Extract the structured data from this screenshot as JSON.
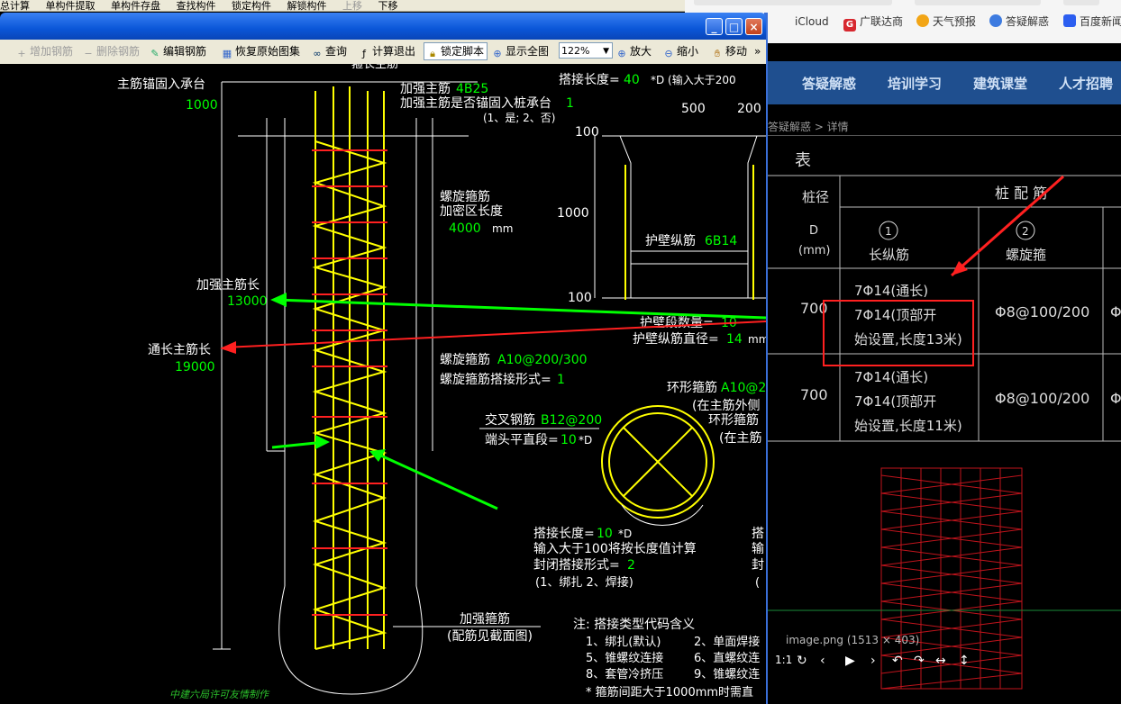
{
  "top_menu": [
    "总计算",
    "单构件提取",
    "单构件存盘",
    "查找构件",
    "锁定构件",
    "解锁构件",
    "上移",
    "下移"
  ],
  "browser": {
    "favorites": [
      {
        "label": "iCloud",
        "icon": "apple-icon"
      },
      {
        "label": "广联达商",
        "icon": "glodon-g-icon",
        "color": "#d7282f"
      },
      {
        "label": "天气预报",
        "icon": "weather-sun-icon",
        "color": "#f2a516"
      },
      {
        "label": "答疑解惑",
        "icon": "bulb-icon",
        "color": "#3d7be0"
      },
      {
        "label": "百度新闻",
        "icon": "baidu-paw-icon",
        "color": "#2c5ef0"
      }
    ],
    "nav": [
      "答疑解惑",
      "培训学习",
      "建筑课堂",
      "人才招聘"
    ],
    "breadcrumb": "答疑解惑 > 详情",
    "table": {
      "title_fragment": "表",
      "col_header_pile": "桩径",
      "col_header_d": "D",
      "col_header_unit": "(mm)",
      "col_header_config": "桩 配 筋",
      "col1_num": "1",
      "col1_label": "长纵筋",
      "col2_num": "2",
      "col2_label": "螺旋箍",
      "rows": [
        {
          "d": "700",
          "long_1": "7Φ14(通长)",
          "long_2": "7Φ14(顶部开",
          "long_3": "始设置,长度13米)",
          "spiral": "Φ8@100/200",
          "extra": "Φ"
        },
        {
          "d": "700",
          "long_1": "7Φ14(通长)",
          "long_2": "7Φ14(顶部开",
          "long_3": "始设置,长度11米)",
          "spiral": "Φ8@100/200",
          "extra": "Φ"
        }
      ]
    },
    "viewer": {
      "caption": "image.png (1513 × 403)",
      "controls": [
        "1:1",
        "↻",
        "‹",
        "▶",
        "›",
        "↶",
        "↷",
        "↔",
        "↕"
      ]
    }
  },
  "window": {
    "toolbar": [
      {
        "label": "增加钢筋",
        "disabled": true,
        "icon": "add-rebar-icon"
      },
      {
        "label": "删除钢筋",
        "disabled": true,
        "icon": "delete-rebar-icon"
      },
      {
        "label": "编辑钢筋",
        "disabled": false,
        "icon": "edit-rebar-icon"
      },
      {
        "label": "恢复原始图集",
        "disabled": false,
        "icon": "restore-icon"
      },
      {
        "label": "查询",
        "disabled": false,
        "icon": "binoculars-icon"
      },
      {
        "label": "计算退出",
        "disabled": false,
        "icon": "calc-exit-icon"
      },
      {
        "label": "锁定脚本",
        "disabled": false,
        "icon": "lock-icon",
        "pressed": true
      },
      {
        "label": "显示全图",
        "disabled": false,
        "icon": "fit-view-icon"
      },
      {
        "label": "放大",
        "disabled": false,
        "icon": "zoom-in-icon"
      },
      {
        "label": "缩小",
        "disabled": false,
        "icon": "zoom-out-icon"
      },
      {
        "label": "移动",
        "disabled": false,
        "icon": "hand-move-icon"
      }
    ],
    "zoom_value": "122%",
    "more": "»"
  },
  "cad": {
    "texts": {
      "top_cut": "箍长主筋",
      "anchor_label": "主筋锚固入承台",
      "anchor_val": "1000",
      "reinforce_main": "加强主筋",
      "reinforce_main_val": "4B25",
      "reinforce_anchor": "加强主筋是否锚固入桩承台",
      "reinforce_anchor_val": "1",
      "reinforce_anchor_opts": "(1、是; 2、否)",
      "lap_len_label": "搭接长度=",
      "lap_len_val": "40",
      "lap_len_unit": "*D (输入大于200",
      "w500": "500",
      "w200": "200",
      "dim100a": "100",
      "dim1000": "1000",
      "dim100b": "100",
      "wall_long": "护壁纵筋",
      "wall_long_val": "6B14",
      "wall_count": "护壁段数量=",
      "wall_count_val": "10",
      "wall_dia": "护壁纵筋直径=",
      "wall_dia_val": "14",
      "wall_dia_unit": "mm",
      "spiral_dense": "螺旋箍筋",
      "spiral_dense2": "加密区长度",
      "spiral_dense_val": "4000",
      "spiral_dense_unit": "mm",
      "reinforce_len": "加强主筋长",
      "reinforce_len_val": "13000",
      "through_len": "通长主筋长",
      "through_len_val": "19000",
      "spiral": "螺旋箍筋",
      "spiral_val": "A10@200/300",
      "spiral_lap": "螺旋箍筋搭接形式=",
      "spiral_lap_val": "1",
      "ring": "环形箍筋",
      "ring_val": "A10@2",
      "ring_note1": "(在主筋外侧",
      "ring_note2": "环形箍筋",
      "ring_note3": "(在主筋",
      "cross": "交叉钢筋",
      "cross_val": "B12@200",
      "end_straight": "端头平直段=",
      "end_straight_val": "10",
      "end_straight_unit": "*D",
      "lap2": "搭接长度=",
      "lap2_val": "10",
      "lap2_unit": "*D",
      "lap2_note": "输入大于100将按长度值计算",
      "closed_lap": "封闭搭接形式=",
      "closed_lap_val": "2",
      "closed_lap_opts": "(1、绑扎  2、焊接)",
      "stir_label": "加强箍筋",
      "stir_note": "(配筋见截面图)",
      "note_title": "注: 搭接类型代码含义",
      "note1": "1、绑扎(默认)",
      "note2": "2、单面焊接",
      "note5": "5、锥螺纹连接",
      "note6": "6、直螺纹连",
      "note8": "8、套管冷挤压",
      "note9": "9、锥螺纹连",
      "note_star": "* 箍筋间距大于1000mm时需直",
      "right_cut1": "搭",
      "right_cut2": "输",
      "right_cut3": "封",
      "right_cut4": "(",
      "watermark": "中建六局许可友情制作"
    }
  },
  "colors": {
    "cad_bg": "#000000",
    "yellow": "#ffff00",
    "green": "#00ff00",
    "red": "#ff2020",
    "white": "#ffffff",
    "title_blue": "#0a56d8"
  }
}
